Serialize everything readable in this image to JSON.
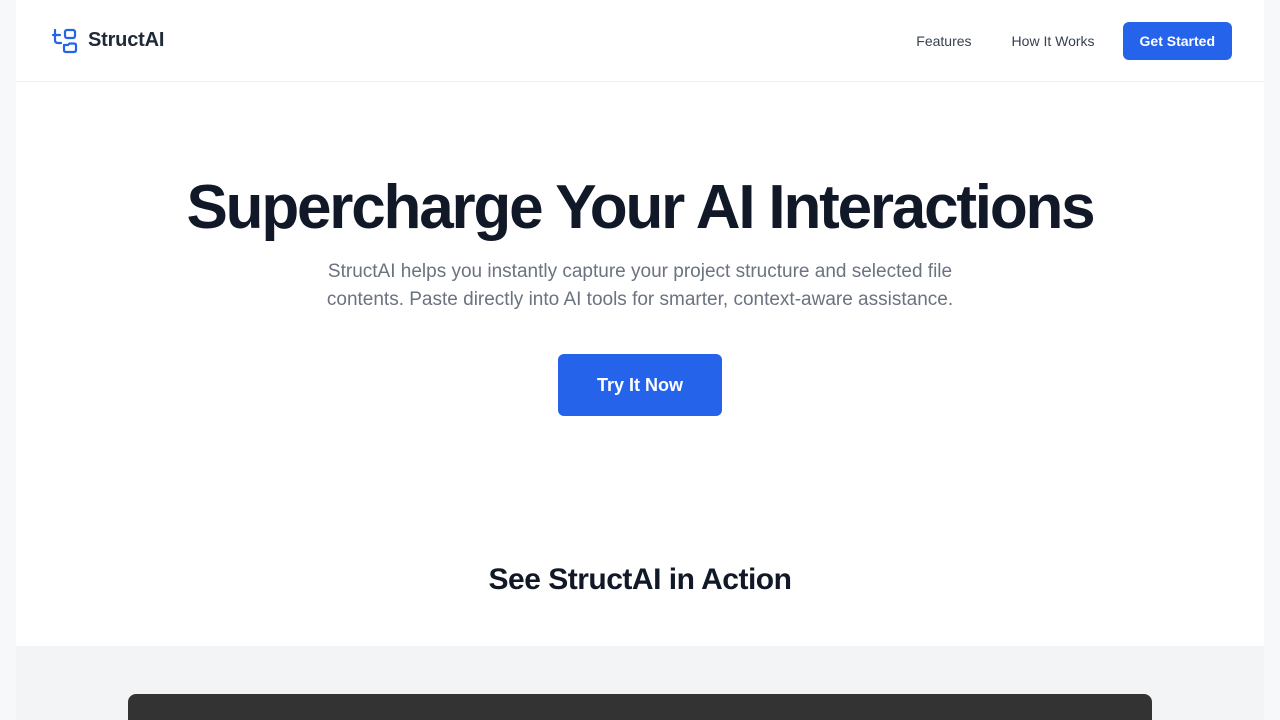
{
  "header": {
    "brand_name": "StructAI",
    "brand_icon": "folder-tree-icon",
    "nav": {
      "features": "Features",
      "how_it_works": "How It Works",
      "get_started": "Get Started"
    }
  },
  "hero": {
    "title": "Supercharge Your AI Interactions",
    "subtitle": "StructAI helps you instantly capture your project structure and selected file contents. Paste directly into AI tools for smarter, context-aware assistance.",
    "cta": "Try It Now"
  },
  "demo": {
    "title": "See StructAI in Action"
  },
  "colors": {
    "accent": "#2563eb",
    "heading": "#111827",
    "muted": "#6b7280",
    "demo_window": "#333333"
  }
}
